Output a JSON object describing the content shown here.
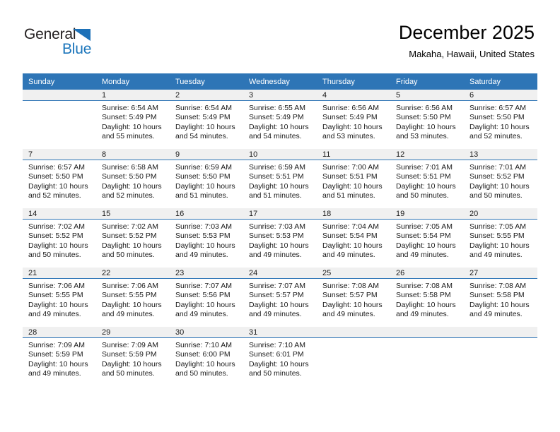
{
  "brand": {
    "name_top": "General",
    "name_bottom": "Blue",
    "triangle_color": "#1d71b8",
    "accent_color": "#2e75b6"
  },
  "header": {
    "title": "December 2025",
    "subtitle": "Makaha, Hawaii, United States"
  },
  "weekday_headers": [
    "Sunday",
    "Monday",
    "Tuesday",
    "Wednesday",
    "Thursday",
    "Friday",
    "Saturday"
  ],
  "weeks": [
    [
      {
        "day": "",
        "sunrise": "",
        "sunset": "",
        "daylight_line1": "",
        "daylight_line2": "",
        "empty": true
      },
      {
        "day": "1",
        "sunrise": "Sunrise: 6:54 AM",
        "sunset": "Sunset: 5:49 PM",
        "daylight_line1": "Daylight: 10 hours",
        "daylight_line2": "and 55 minutes."
      },
      {
        "day": "2",
        "sunrise": "Sunrise: 6:54 AM",
        "sunset": "Sunset: 5:49 PM",
        "daylight_line1": "Daylight: 10 hours",
        "daylight_line2": "and 54 minutes."
      },
      {
        "day": "3",
        "sunrise": "Sunrise: 6:55 AM",
        "sunset": "Sunset: 5:49 PM",
        "daylight_line1": "Daylight: 10 hours",
        "daylight_line2": "and 54 minutes."
      },
      {
        "day": "4",
        "sunrise": "Sunrise: 6:56 AM",
        "sunset": "Sunset: 5:49 PM",
        "daylight_line1": "Daylight: 10 hours",
        "daylight_line2": "and 53 minutes."
      },
      {
        "day": "5",
        "sunrise": "Sunrise: 6:56 AM",
        "sunset": "Sunset: 5:50 PM",
        "daylight_line1": "Daylight: 10 hours",
        "daylight_line2": "and 53 minutes."
      },
      {
        "day": "6",
        "sunrise": "Sunrise: 6:57 AM",
        "sunset": "Sunset: 5:50 PM",
        "daylight_line1": "Daylight: 10 hours",
        "daylight_line2": "and 52 minutes."
      }
    ],
    [
      {
        "day": "7",
        "sunrise": "Sunrise: 6:57 AM",
        "sunset": "Sunset: 5:50 PM",
        "daylight_line1": "Daylight: 10 hours",
        "daylight_line2": "and 52 minutes."
      },
      {
        "day": "8",
        "sunrise": "Sunrise: 6:58 AM",
        "sunset": "Sunset: 5:50 PM",
        "daylight_line1": "Daylight: 10 hours",
        "daylight_line2": "and 52 minutes."
      },
      {
        "day": "9",
        "sunrise": "Sunrise: 6:59 AM",
        "sunset": "Sunset: 5:50 PM",
        "daylight_line1": "Daylight: 10 hours",
        "daylight_line2": "and 51 minutes."
      },
      {
        "day": "10",
        "sunrise": "Sunrise: 6:59 AM",
        "sunset": "Sunset: 5:51 PM",
        "daylight_line1": "Daylight: 10 hours",
        "daylight_line2": "and 51 minutes."
      },
      {
        "day": "11",
        "sunrise": "Sunrise: 7:00 AM",
        "sunset": "Sunset: 5:51 PM",
        "daylight_line1": "Daylight: 10 hours",
        "daylight_line2": "and 51 minutes."
      },
      {
        "day": "12",
        "sunrise": "Sunrise: 7:01 AM",
        "sunset": "Sunset: 5:51 PM",
        "daylight_line1": "Daylight: 10 hours",
        "daylight_line2": "and 50 minutes."
      },
      {
        "day": "13",
        "sunrise": "Sunrise: 7:01 AM",
        "sunset": "Sunset: 5:52 PM",
        "daylight_line1": "Daylight: 10 hours",
        "daylight_line2": "and 50 minutes."
      }
    ],
    [
      {
        "day": "14",
        "sunrise": "Sunrise: 7:02 AM",
        "sunset": "Sunset: 5:52 PM",
        "daylight_line1": "Daylight: 10 hours",
        "daylight_line2": "and 50 minutes."
      },
      {
        "day": "15",
        "sunrise": "Sunrise: 7:02 AM",
        "sunset": "Sunset: 5:52 PM",
        "daylight_line1": "Daylight: 10 hours",
        "daylight_line2": "and 50 minutes."
      },
      {
        "day": "16",
        "sunrise": "Sunrise: 7:03 AM",
        "sunset": "Sunset: 5:53 PM",
        "daylight_line1": "Daylight: 10 hours",
        "daylight_line2": "and 49 minutes."
      },
      {
        "day": "17",
        "sunrise": "Sunrise: 7:03 AM",
        "sunset": "Sunset: 5:53 PM",
        "daylight_line1": "Daylight: 10 hours",
        "daylight_line2": "and 49 minutes."
      },
      {
        "day": "18",
        "sunrise": "Sunrise: 7:04 AM",
        "sunset": "Sunset: 5:54 PM",
        "daylight_line1": "Daylight: 10 hours",
        "daylight_line2": "and 49 minutes."
      },
      {
        "day": "19",
        "sunrise": "Sunrise: 7:05 AM",
        "sunset": "Sunset: 5:54 PM",
        "daylight_line1": "Daylight: 10 hours",
        "daylight_line2": "and 49 minutes."
      },
      {
        "day": "20",
        "sunrise": "Sunrise: 7:05 AM",
        "sunset": "Sunset: 5:55 PM",
        "daylight_line1": "Daylight: 10 hours",
        "daylight_line2": "and 49 minutes."
      }
    ],
    [
      {
        "day": "21",
        "sunrise": "Sunrise: 7:06 AM",
        "sunset": "Sunset: 5:55 PM",
        "daylight_line1": "Daylight: 10 hours",
        "daylight_line2": "and 49 minutes."
      },
      {
        "day": "22",
        "sunrise": "Sunrise: 7:06 AM",
        "sunset": "Sunset: 5:55 PM",
        "daylight_line1": "Daylight: 10 hours",
        "daylight_line2": "and 49 minutes."
      },
      {
        "day": "23",
        "sunrise": "Sunrise: 7:07 AM",
        "sunset": "Sunset: 5:56 PM",
        "daylight_line1": "Daylight: 10 hours",
        "daylight_line2": "and 49 minutes."
      },
      {
        "day": "24",
        "sunrise": "Sunrise: 7:07 AM",
        "sunset": "Sunset: 5:57 PM",
        "daylight_line1": "Daylight: 10 hours",
        "daylight_line2": "and 49 minutes."
      },
      {
        "day": "25",
        "sunrise": "Sunrise: 7:08 AM",
        "sunset": "Sunset: 5:57 PM",
        "daylight_line1": "Daylight: 10 hours",
        "daylight_line2": "and 49 minutes."
      },
      {
        "day": "26",
        "sunrise": "Sunrise: 7:08 AM",
        "sunset": "Sunset: 5:58 PM",
        "daylight_line1": "Daylight: 10 hours",
        "daylight_line2": "and 49 minutes."
      },
      {
        "day": "27",
        "sunrise": "Sunrise: 7:08 AM",
        "sunset": "Sunset: 5:58 PM",
        "daylight_line1": "Daylight: 10 hours",
        "daylight_line2": "and 49 minutes."
      }
    ],
    [
      {
        "day": "28",
        "sunrise": "Sunrise: 7:09 AM",
        "sunset": "Sunset: 5:59 PM",
        "daylight_line1": "Daylight: 10 hours",
        "daylight_line2": "and 49 minutes."
      },
      {
        "day": "29",
        "sunrise": "Sunrise: 7:09 AM",
        "sunset": "Sunset: 5:59 PM",
        "daylight_line1": "Daylight: 10 hours",
        "daylight_line2": "and 50 minutes."
      },
      {
        "day": "30",
        "sunrise": "Sunrise: 7:10 AM",
        "sunset": "Sunset: 6:00 PM",
        "daylight_line1": "Daylight: 10 hours",
        "daylight_line2": "and 50 minutes."
      },
      {
        "day": "31",
        "sunrise": "Sunrise: 7:10 AM",
        "sunset": "Sunset: 6:01 PM",
        "daylight_line1": "Daylight: 10 hours",
        "daylight_line2": "and 50 minutes."
      },
      {
        "day": "",
        "sunrise": "",
        "sunset": "",
        "daylight_line1": "",
        "daylight_line2": "",
        "empty": true
      },
      {
        "day": "",
        "sunrise": "",
        "sunset": "",
        "daylight_line1": "",
        "daylight_line2": "",
        "empty": true
      },
      {
        "day": "",
        "sunrise": "",
        "sunset": "",
        "daylight_line1": "",
        "daylight_line2": "",
        "empty": true
      }
    ]
  ]
}
